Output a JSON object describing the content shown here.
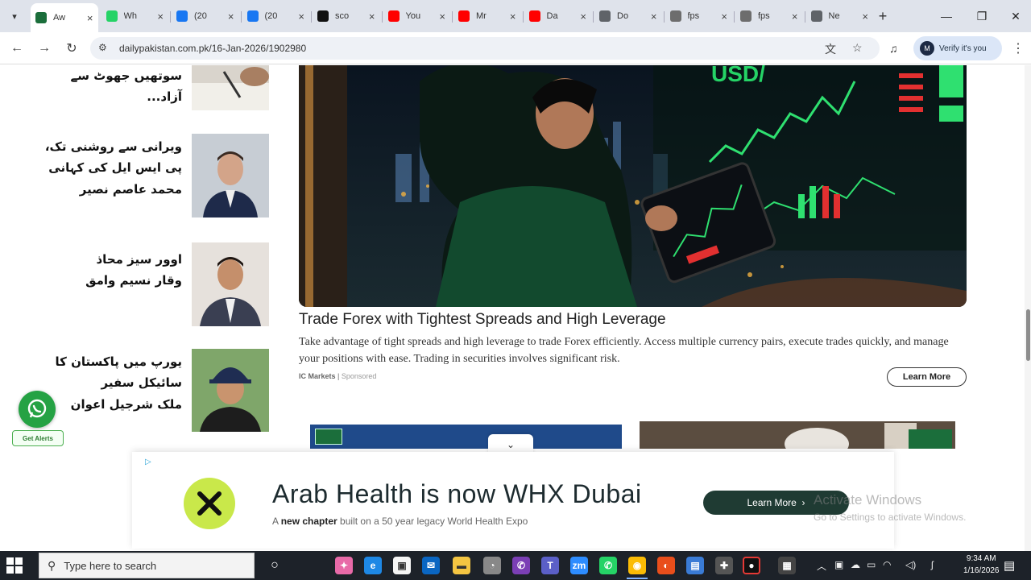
{
  "browser": {
    "tabs": [
      {
        "title": "Aw",
        "icon": "daily-pakistan-icon",
        "color": "#1b6e3b",
        "active": true
      },
      {
        "title": "Wh",
        "icon": "whatsapp-icon",
        "color": "#25d366"
      },
      {
        "title": "(20",
        "icon": "facebook-icon",
        "color": "#1877f2"
      },
      {
        "title": "(20",
        "icon": "facebook-icon",
        "color": "#1877f2"
      },
      {
        "title": "sco",
        "icon": "x-icon",
        "color": "#111111"
      },
      {
        "title": "You",
        "icon": "youtube-icon",
        "color": "#ff0000"
      },
      {
        "title": "Mr",
        "icon": "youtube-icon",
        "color": "#ff0000"
      },
      {
        "title": "Da",
        "icon": "youtube-icon",
        "color": "#ff0000"
      },
      {
        "title": "Do",
        "icon": "globe-icon",
        "color": "#5f6368"
      },
      {
        "title": "fps",
        "icon": "fps-icon",
        "color": "#6d6d6d"
      },
      {
        "title": "fps",
        "icon": "fps-icon",
        "color": "#6d6d6d"
      },
      {
        "title": "Ne",
        "icon": "chrome-icon",
        "color": "#5f6368"
      }
    ],
    "url": "dailypakistan.com.pk/16-Jan-2026/1902980",
    "profile_label": "Verify it's you"
  },
  "sidebar": {
    "items": [
      {
        "text": "سوتھیں جھوٹ سے آزاد..."
      },
      {
        "text": "ویرانی سے روشنی تک، پی ایس ایل کی کہانی\nمحمد عاصم نصیر"
      },
      {
        "text": "اوور سیز محاذ\nوقار نسیم وامق"
      },
      {
        "text": "یورپ میں پاکستان کا سائیکل سفیر\nملک شرجیل اعوان"
      }
    ]
  },
  "ad": {
    "title": "Trade Forex with Tightest Spreads and High Leverage",
    "body": "Take advantage of tight spreads and high leverage to trade Forex efficiently. Access multiple currency pairs, execute trades quickly, and manage your positions with ease. Trading in securities involves significant risk.",
    "source": "IC Markets",
    "sponsored": "Sponsored",
    "cta": "Learn More",
    "image_text": "USD/"
  },
  "whatsapp": {
    "label": "Get Alerts"
  },
  "banner": {
    "headline": "Arab Health is now WHX Dubai",
    "sub_bold": "new chapter",
    "sub_prefix": "A ",
    "sub_suffix": " built on a 50 year legacy World Health Expo",
    "cta": "Learn More"
  },
  "watermark": {
    "line1": "Activate Windows",
    "line2": "Go to Settings to activate Windows."
  },
  "taskbar": {
    "search_placeholder": "Type here to search",
    "time": "9:34 AM",
    "date": "1/16/2026"
  },
  "colors": {
    "tab_strip": "#dfe3eb",
    "taskbar": "#1d2229",
    "whatsapp_green": "#25a244",
    "banner_cta": "#1f3b33",
    "whx_logo": "#c9e84a"
  }
}
